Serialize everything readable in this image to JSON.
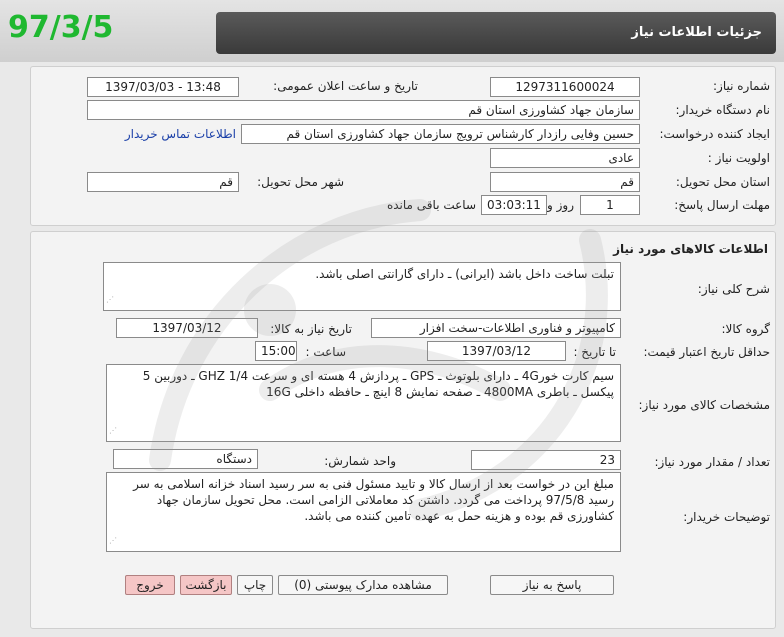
{
  "header": {
    "title": "جزئیات اطلاعات نیاز",
    "corner_date": "97/3/5"
  },
  "need_info": {
    "need_number_label": "شماره نیاز:",
    "need_number": "1297311600024",
    "announce_label": "تاریخ و ساعت اعلان عمومی:",
    "announce_value": "1397/03/03 - 13:48",
    "buyer_org_label": "نام دستگاه خریدار:",
    "buyer_org": "سازمان جهاد کشاورزی استان قم",
    "requester_label": "ایجاد کننده درخواست:",
    "requester": "حسین وفایی رازدار کارشناس ترویج سازمان جهاد کشاورزی استان قم",
    "contact_link": "اطلاعات تماس خریدار",
    "priority_label": "اولویت نیاز :",
    "priority": "عادی",
    "province_label": "استان محل تحویل:",
    "province": "قم",
    "city_label": "شهر محل تحویل:",
    "city": "قم",
    "deadline_label": "مهلت ارسال پاسخ:",
    "days": "1",
    "days_label": "روز و",
    "time_left": "03:03:11",
    "time_left_label": "ساعت باقی مانده"
  },
  "goods": {
    "section_title": "اطلاعات کالاهای مورد نیاز",
    "general_desc_label": "شرح کلی نیاز:",
    "general_desc": "تبلت ساخت داخل باشد (ایرانی) ـ دارای گارانتی اصلی باشد.",
    "goods_group_label": "گروه کالا:",
    "goods_group": "کامپیوتر و فناوری اطلاعات-سخت افزار",
    "need_date_label": "تاریخ نیاز به کالا:",
    "need_date": "1397/03/12",
    "min_validity_label": "حداقل تاریخ اعتبار قیمت:",
    "until_date_label": "تا تاریخ :",
    "until_date": "1397/03/12",
    "hour_label": "ساعت :",
    "hour": "15:00",
    "specs_label": "مشخصات کالای مورد نیاز:",
    "specs": "سیم کارت خور4G ـ دارای بلوتوث ـ GPS ـ پردازش 4 هسته ای و سرعت GHZ 1/4 ـ دوربین 5 پیکسل ـ باطری 4800MA ـ صفحه نمایش 8 اینچ ـ حافظه داخلی 16G",
    "qty_label": "تعداد / مقدار مورد نیاز:",
    "qty": "23",
    "unit_label": "واحد شمارش:",
    "unit": "دستگاه",
    "buyer_notes_label": "توضیحات خریدار:",
    "buyer_notes": "مبلغ این در خواست بعد از ارسال کالا و تایید مسئول فنی به سر رسید اسناد خزانه اسلامی به سر رسید 97/5/8 پرداخت می گردد. داشتن کد معاملاتی الزامی است. محل تحویل سازمان جهاد کشاورزی قم بوده و هزینه حمل به عهده تامین کننده می باشد."
  },
  "buttons": {
    "reply": "پاسخ به نیاز",
    "attachments": "مشاهده مدارک پیوستی (0)",
    "print": "چاپ",
    "back": "بازگشت",
    "exit": "خروج"
  },
  "colors": {
    "title_bar": "#474747",
    "corner_date": "#1fb830",
    "link": "#1a3fa8",
    "danger_button": "#f5c6c6"
  }
}
